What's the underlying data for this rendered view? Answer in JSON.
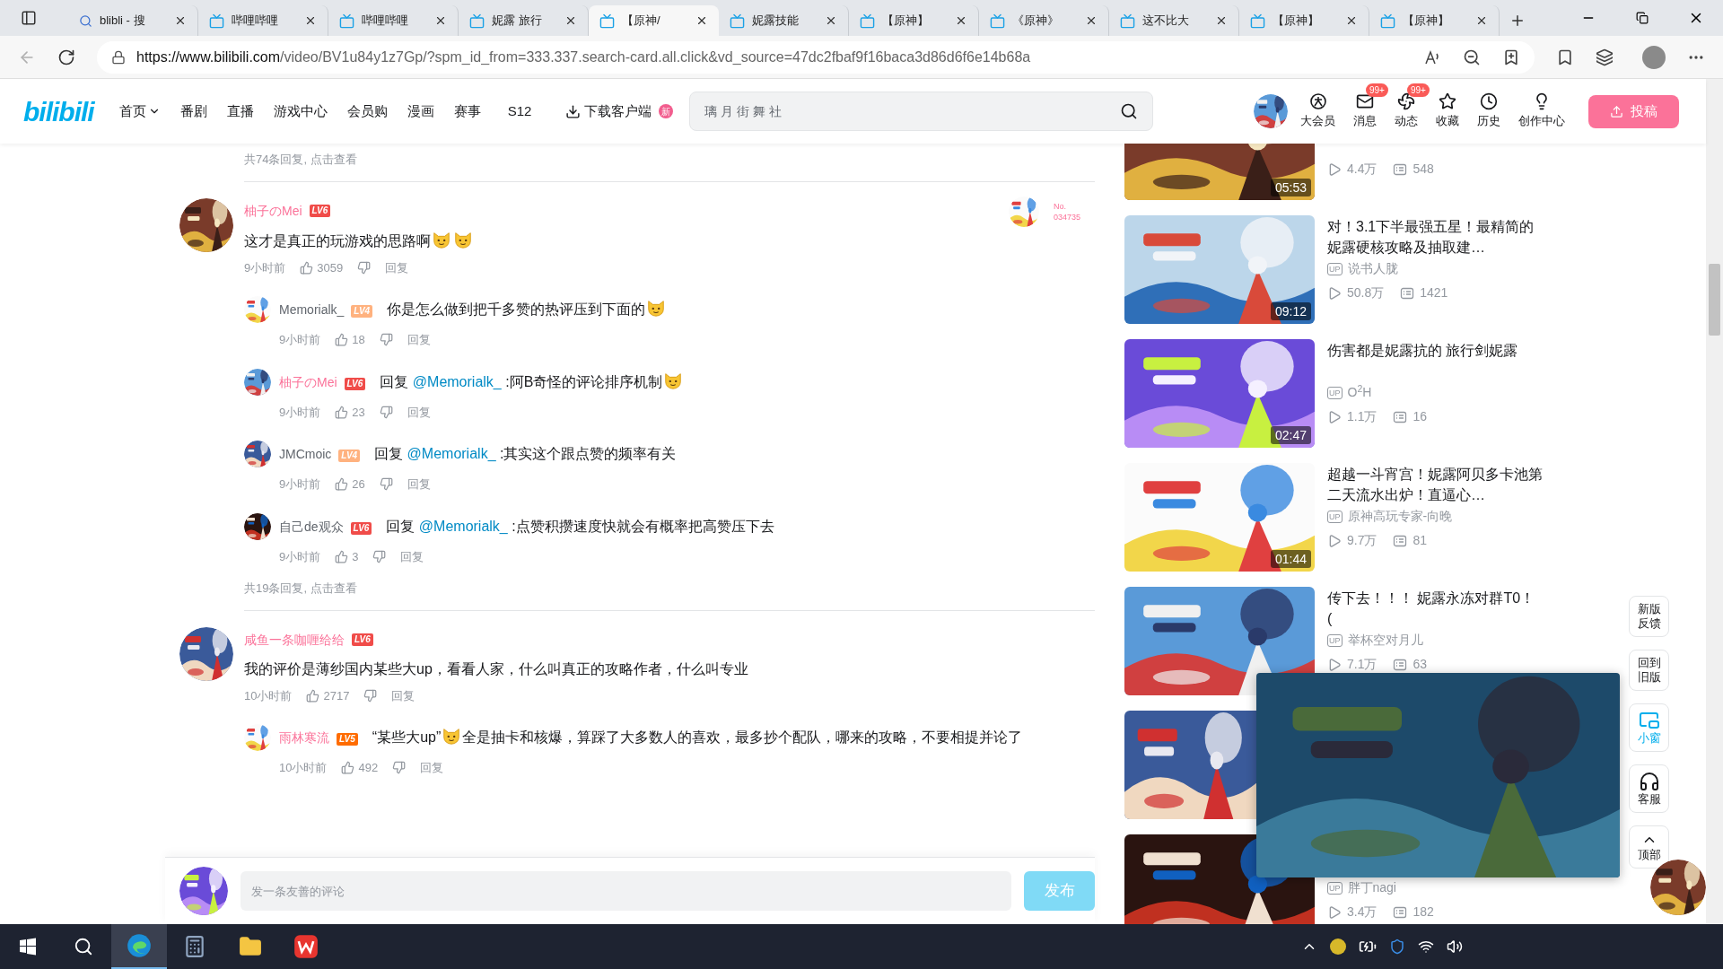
{
  "browser": {
    "tabs": [
      {
        "kind": "search",
        "title": "blibli - 搜",
        "selected": false
      },
      {
        "kind": "bili",
        "title": "哔哩哔哩",
        "selected": false
      },
      {
        "kind": "bili",
        "title": "哔哩哔哩",
        "selected": false
      },
      {
        "kind": "bili",
        "title": "妮露 旅行",
        "selected": false
      },
      {
        "kind": "bili",
        "title": "【原神/",
        "selected": true
      },
      {
        "kind": "bili",
        "title": "妮露技能",
        "selected": false
      },
      {
        "kind": "bili",
        "title": "【原神】",
        "selected": false
      },
      {
        "kind": "bili",
        "title": "《原神》",
        "selected": false
      },
      {
        "kind": "bili",
        "title": "这不比大",
        "selected": false
      },
      {
        "kind": "bili",
        "title": "【原神】",
        "selected": false
      },
      {
        "kind": "bili",
        "title": "【原神】",
        "selected": false
      }
    ],
    "url_host": "https://www.bilibili.com",
    "url_path": "/video/BV1u84y1z7Gp/?spm_id_from=333.337.search-card.all.click&vd_source=47dc2fbaf9f16baca3d86d6f6e14b68a"
  },
  "header": {
    "logo": "bilibili",
    "nav": [
      {
        "kind": "dropdown",
        "label": "首页"
      },
      {
        "kind": "plain",
        "label": "番剧"
      },
      {
        "kind": "plain",
        "label": "直播"
      },
      {
        "kind": "plain",
        "label": "游戏中心"
      },
      {
        "kind": "plain",
        "label": "会员购"
      },
      {
        "kind": "plain",
        "label": "漫画"
      },
      {
        "kind": "plain",
        "label": "赛事"
      },
      {
        "kind": "plain",
        "label": "S12"
      }
    ],
    "download": {
      "label": "下载客户端",
      "badge": "新"
    },
    "search": {
      "placeholder": "璃 月 街 舞 社"
    },
    "actions": [
      {
        "kind": "vip",
        "label": "大会员"
      },
      {
        "kind": "message",
        "label": "消息",
        "badge": "99+"
      },
      {
        "kind": "dynamic",
        "label": "动态",
        "badge": "99+"
      },
      {
        "kind": "favorite",
        "label": "收藏"
      },
      {
        "kind": "history",
        "label": "历史"
      },
      {
        "kind": "creator",
        "label": "创作中心"
      }
    ],
    "upload": "投稿"
  },
  "comments": {
    "top_more": "共74条回复, 点击查看",
    "threads": [
      {
        "user": "柚子のMei",
        "vip": true,
        "level": {
          "label": "LV6",
          "color": "#f04c49"
        },
        "parts": [
          {
            "kind": "text",
            "text": "这才是真正的玩游戏的思路啊"
          },
          {
            "kind": "emoji"
          },
          {
            "kind": "emoji"
          }
        ],
        "time": "9小时前",
        "likes": "3059",
        "reply": "回复",
        "fan_no": "No.",
        "fan_id": "034735",
        "replies": [
          {
            "user": "Memorialk_",
            "vip": false,
            "level": {
              "label": "LV4",
              "color": "#ffb27f"
            },
            "parts": [
              {
                "kind": "text",
                "text": "你是怎么做到把千多赞的热评压到下面的"
              },
              {
                "kind": "emoji"
              }
            ],
            "time": "9小时前",
            "likes": "18",
            "reply": "回复"
          },
          {
            "user": "柚子のMei",
            "vip": true,
            "level": {
              "label": "LV6",
              "color": "#f04c49"
            },
            "prefix": "回复",
            "mention": "@Memorialk_",
            "parts": [
              {
                "kind": "text",
                "text": ":阿B奇怪的评论排序机制"
              },
              {
                "kind": "emoji"
              }
            ],
            "time": "9小时前",
            "likes": "23",
            "reply": "回复"
          },
          {
            "user": "JMCmoic",
            "vip": false,
            "level": {
              "label": "LV4",
              "color": "#ffb27f"
            },
            "prefix": "回复",
            "mention": "@Memorialk_",
            "parts": [
              {
                "kind": "text",
                "text": ":其实这个跟点赞的频率有关"
              }
            ],
            "time": "9小时前",
            "likes": "26",
            "reply": "回复"
          },
          {
            "user": "自己de观众",
            "vip": false,
            "level": {
              "label": "LV6",
              "color": "#f04c49"
            },
            "prefix": "回复",
            "mention": "@Memorialk_",
            "parts": [
              {
                "kind": "text",
                "text": ":点赞积攒速度快就会有概率把高赞压下去"
              }
            ],
            "time": "9小时前",
            "likes": "3",
            "reply": "回复"
          }
        ],
        "more": "共19条回复, 点击查看"
      },
      {
        "user": "咸鱼一条咖喱给给",
        "vip": true,
        "level": {
          "label": "LV6",
          "color": "#f04c49"
        },
        "parts": [
          {
            "kind": "text",
            "text": "我的评价是薄纱国内某些大up，看看人家，什么叫真正的攻略作者，什么叫专业"
          }
        ],
        "time": "10小时前",
        "likes": "2717",
        "reply": "回复",
        "replies": [
          {
            "user": "雨林寒流",
            "vip": true,
            "level": {
              "label": "LV5",
              "color": "#ff6c00"
            },
            "parts": [
              {
                "kind": "text",
                "text": "“某些大up”"
              },
              {
                "kind": "emoji"
              },
              {
                "kind": "text",
                "text": "全是抽卡和核爆，算踩了大多数人的喜欢，最多抄个配队，哪来的攻略，不要相提并论了"
              }
            ],
            "time": "10小时前",
            "likes": "492",
            "reply": "回复"
          }
        ]
      }
    ],
    "input": {
      "placeholder": "发一条友善的评论",
      "submit": "发布"
    }
  },
  "related": [
    {
      "kind": "video",
      "duration": "05:53",
      "views": "4.4万",
      "danmaku": "548"
    },
    {
      "kind": "video",
      "duration": "09:12",
      "title": "对！3.1下半最强五星！最精简的妮露硬核攻略及抽取建…",
      "up_tag": "UP",
      "up": "说书人胧",
      "views": "50.8万",
      "danmaku": "1421"
    },
    {
      "kind": "video",
      "duration": "02:47",
      "title": "伤害都是妮露抗的 旅行剑妮露",
      "up_tag": "UP",
      "up": "O$^{2}$H",
      "views": "1.1万",
      "danmaku": "16"
    },
    {
      "kind": "video",
      "duration": "01:44",
      "title": "超越一斗宵宫！妮露阿贝多卡池第二天流水出炉！直逼心…",
      "up_tag": "UP",
      "up": "原神高玩专家-向晚",
      "views": "9.7万",
      "danmaku": "81"
    },
    {
      "kind": "video",
      "title": "传下去！！！ 妮露永冻对群T0！ (",
      "up_tag": "UP",
      "up": "举杯空对月儿",
      "views": "7.1万",
      "danmaku": "63"
    },
    {
      "kind": "covered"
    },
    {
      "kind": "video",
      "up_tag": "UP",
      "up": "胖丁nagi",
      "views": "3.4万",
      "danmaku": "182"
    }
  ],
  "side_buttons": [
    {
      "kind": "plain",
      "label": "新版反馈"
    },
    {
      "kind": "plain",
      "label": "回到旧版"
    },
    {
      "kind": "mini",
      "label": "小窗"
    },
    {
      "kind": "service",
      "label": "客服"
    },
    {
      "kind": "top",
      "label": "顶部"
    }
  ],
  "taskbar": {
    "apps": [
      {
        "kind": "start",
        "selected": false
      },
      {
        "kind": "search",
        "selected": false
      },
      {
        "kind": "edge",
        "selected": true
      },
      {
        "kind": "calculator",
        "selected": false
      },
      {
        "kind": "explorer",
        "selected": false
      },
      {
        "kind": "wps",
        "selected": false
      }
    ]
  }
}
